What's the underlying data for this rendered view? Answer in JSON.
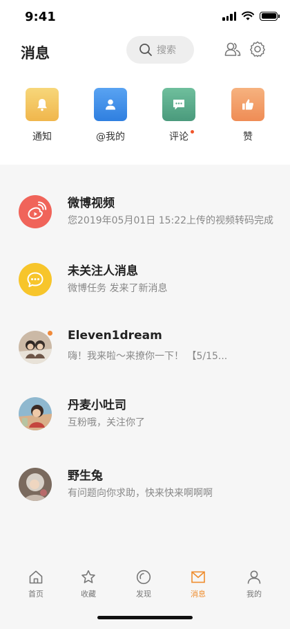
{
  "status_bar": {
    "time": "9:41"
  },
  "header": {
    "title": "消息",
    "search_placeholder": "搜索",
    "icons": [
      "contacts-icon",
      "settings-icon"
    ]
  },
  "shortcuts": [
    {
      "label": "通知",
      "icon": "bell-icon",
      "color": "#f3c15a"
    },
    {
      "label": "@我的",
      "icon": "person-icon",
      "color": "#3e8ee8"
    },
    {
      "label": "评论",
      "icon": "comment-icon",
      "color": "#5aa88a",
      "has_dot": true
    },
    {
      "label": "赞",
      "icon": "thumbs-up-icon",
      "color": "#f2a06a"
    }
  ],
  "messages": [
    {
      "name": "微博视频",
      "preview": "您2019年05月01日 15:22上传的视频转码完成",
      "avatar": "weibo-video-icon",
      "color": "#f0645a"
    },
    {
      "name": "未关注人消息",
      "preview": "微博任务 发来了新消息",
      "avatar": "chat-bubble-icon",
      "color": "#f7c52b"
    },
    {
      "name": "Eleven1dream",
      "preview": " 嗨！我来啦～来撩你一下！ 【5/15...",
      "avatar": "user-photo",
      "unread": true
    },
    {
      "name": "丹麦小吐司",
      "preview": "互粉哦，关注你了",
      "avatar": "user-photo"
    },
    {
      "name": "野生兔",
      "preview": "有问题向你求助，快来快来啊啊啊",
      "avatar": "user-photo"
    }
  ],
  "tabbar": {
    "items": [
      {
        "label": "首页",
        "icon": "home-icon"
      },
      {
        "label": "收藏",
        "icon": "star-icon"
      },
      {
        "label": "发现",
        "icon": "discover-icon"
      },
      {
        "label": "消息",
        "icon": "mail-icon",
        "active": true
      },
      {
        "label": "我的",
        "icon": "profile-icon"
      }
    ],
    "active_color": "#ef8c2c"
  }
}
